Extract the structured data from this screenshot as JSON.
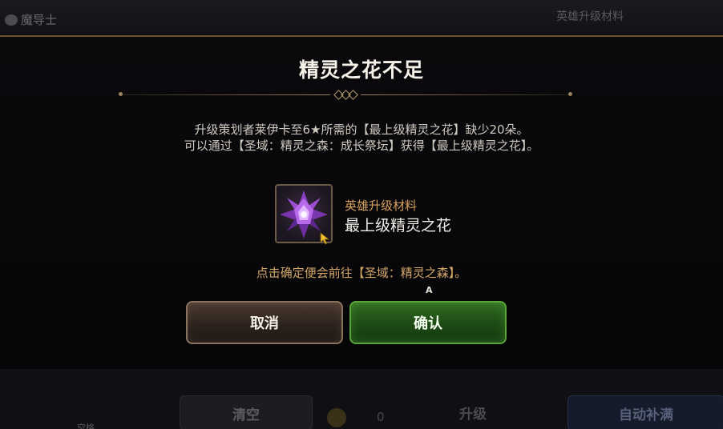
{
  "background": {
    "logo_text": "魔导士",
    "top_right_label": "英雄升级材料",
    "clear_button": "清空",
    "upgrade_button": "升级",
    "autofill_button": "自动补满",
    "coin_amount": "0",
    "slot_label": "空格"
  },
  "dialog": {
    "title": "精灵之花不足",
    "message_line1": "升级策划者莱伊卡至6★所需的【最上级精灵之花】缺少20朵。",
    "message_line2": "可以通过【圣域：精灵之森：成长祭坛】获得【最上级精灵之花】。",
    "item": {
      "category": "英雄升级材料",
      "name": "最上级精灵之花",
      "icon": "purple-crystal-flower-icon"
    },
    "hint": "点击确定便会前往【圣域：精灵之森】。",
    "confirm_key_hint": "A",
    "cancel_label": "取消",
    "confirm_label": "确认"
  },
  "colors": {
    "accent_gold": "#d4a76a",
    "confirm_green": "#5aa43a",
    "cancel_brown": "#8a7260"
  }
}
